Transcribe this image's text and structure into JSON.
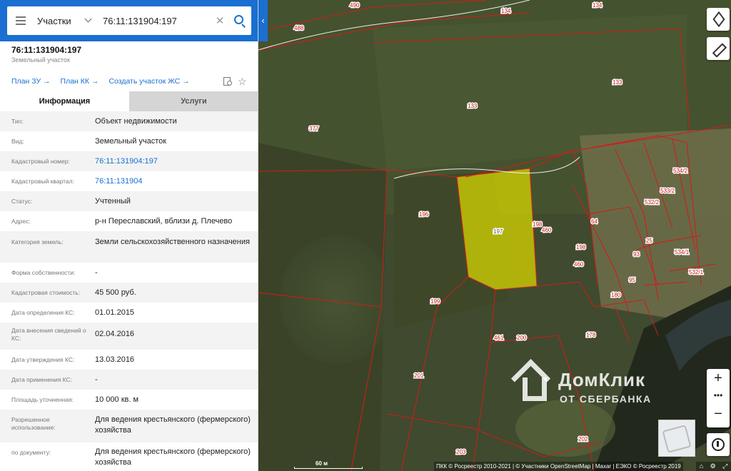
{
  "search": {
    "category": "Участки",
    "query": "76:11:131904:197",
    "clear_icon": "close-icon",
    "search_icon": "search-icon"
  },
  "object": {
    "cadastral_number": "76:11:131904:197",
    "type_label": "Земельный участок"
  },
  "links": [
    {
      "label": "План ЗУ →"
    },
    {
      "label": "План КК →"
    },
    {
      "label": "Создать участок ЖС →"
    }
  ],
  "tabs": [
    {
      "label": "Информация",
      "active": true
    },
    {
      "label": "Услуги",
      "active": false
    }
  ],
  "info_rows": [
    {
      "key": "Тип:",
      "value": "Объект недвижимости"
    },
    {
      "key": "Вид:",
      "value": "Земельный участок"
    },
    {
      "key": "Кадастровый номер:",
      "value": "76:11:131904:197",
      "link": true
    },
    {
      "key": "Кадастровый квартал:",
      "value": "76:11:131904",
      "link": true
    },
    {
      "key": "Статус:",
      "value": "Учтенный"
    },
    {
      "key": "Адрес:",
      "value": "р-н Переславский, вблизи д. Плечево"
    },
    {
      "key": "Категория земель:",
      "value": "Земли сельскохозяйственного назначения"
    },
    {
      "key": "Форма собственности:",
      "value": "-"
    },
    {
      "key": "Кадастровая стоимость:",
      "value": "45 500 руб."
    },
    {
      "key": "Дата определения КС:",
      "value": "01.01.2015"
    },
    {
      "key": "Дата внесения сведений о КС:",
      "value": "02.04.2016"
    },
    {
      "key": "Дата утверждения КС:",
      "value": "13.03.2016"
    },
    {
      "key": "Дата применения КС:",
      "value": "-"
    },
    {
      "key": "Площадь уточненная:",
      "value": "10 000 кв. м"
    },
    {
      "key": "Разрешенное использование:",
      "value": "Для ведения крестьянского (фермерского) хозяйства"
    },
    {
      "key": "по документу:",
      "value": "Для ведения крестьянского (фермерского) хозяйства"
    }
  ],
  "map": {
    "parcel_labels": [
      "490",
      "134",
      "134",
      "488",
      "133",
      "133",
      "377",
      "196",
      "197",
      "198",
      "460",
      "198",
      "460",
      "64",
      "93",
      "95",
      "25",
      "180",
      "534/2",
      "533/2",
      "532/2",
      "534/1",
      "532/1",
      "199",
      "461",
      "200",
      "178",
      "201",
      "202",
      "203"
    ],
    "highlight_color": "#e6e600",
    "boundary_color": "#d41a1a",
    "scale_label": "60 м",
    "attribution": "ПКК © Росреестр 2010-2021 | © Участники OpenStreetMap | Maxar | ЕЭКО © Росреестр 2019",
    "watermark_title": "ДомКлик",
    "watermark_sub": "ОТ СБЕРБАНКА",
    "zoom_in": "+",
    "zoom_more": "•••",
    "zoom_out": "−"
  }
}
